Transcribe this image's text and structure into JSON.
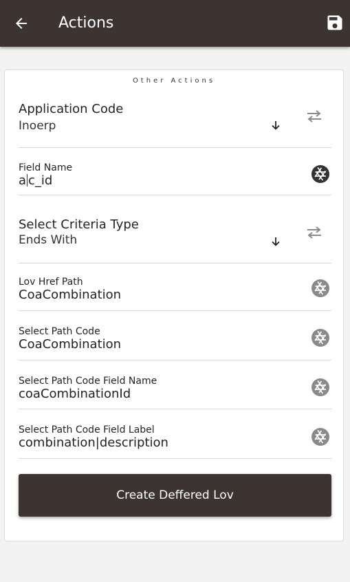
{
  "header": {
    "title": "Actions",
    "back_icon": "arrow-left-icon",
    "save_icon": "floppy-save-icon"
  },
  "section": {
    "title": "Other Actions"
  },
  "fields": {
    "application_code": {
      "label": "Application Code",
      "value": "Inoerp"
    },
    "field_name": {
      "label": "Field Name",
      "value_before_cursor": "a",
      "value_after_cursor": "c_id"
    },
    "criteria_type": {
      "label": "Select Criteria Type",
      "value": "Ends With"
    },
    "lov_href_path": {
      "label": "Lov Href Path",
      "value": "CoaCombination"
    },
    "select_path_code": {
      "label": "Select Path Code",
      "value": "CoaCombination"
    },
    "select_path_code_field_name": {
      "label": "Select Path Code Field Name",
      "value": "coaCombinationId"
    },
    "select_path_code_field_label": {
      "label": "Select Path Code Field Label",
      "value": "combination|description"
    }
  },
  "create_button": {
    "label": "Create Deffered Lov"
  },
  "colors": {
    "appbar": "#3b3431",
    "button": "#3b3431",
    "page_bg": "#f2f2f2",
    "card_bg": "#ffffff",
    "icon_gray": "#8a8a8a",
    "icon_dark": "#333333"
  }
}
